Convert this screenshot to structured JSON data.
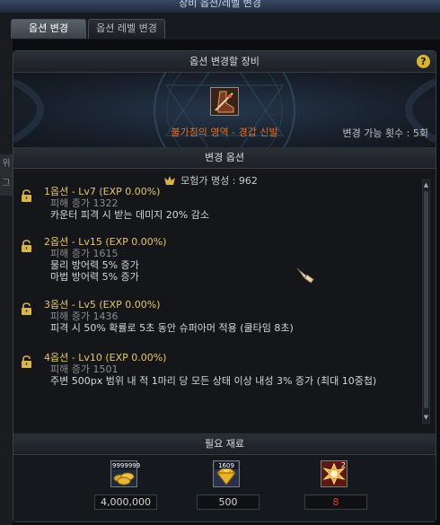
{
  "window": {
    "title": "장비 옵션/레벨 변경"
  },
  "tabs": [
    {
      "label": "옵션 변경",
      "active": true
    },
    {
      "label": "옵션 레벨 변경",
      "active": false
    }
  ],
  "side_strip": {
    "text": "위 그"
  },
  "equipment_section": {
    "title": "옵션 변경할 장비",
    "help_label": "?",
    "item_name": "불가침의 영역 - 경갑 신발",
    "change_count_label": "변경 가능 횟수 : 5회"
  },
  "options_section": {
    "title": "변경 옵션",
    "reputation": "모험가 명성 : 962",
    "options": [
      {
        "title": "1옵션 - Lv7 (EXP 0.00%)",
        "damage": "피해 증가 1322",
        "effects": [
          "카운터 피격 시 받는 데미지 20% 감소"
        ]
      },
      {
        "title": "2옵션 - Lv15 (EXP 0.00%)",
        "damage": "피해 증가 1615",
        "effects": [
          "물리 방어력 5% 증가",
          "마법 방어력 5% 증가"
        ]
      },
      {
        "title": "3옵션 - Lv5 (EXP 0.00%)",
        "damage": "피해 증가 1436",
        "effects": [
          "피격 시 50% 확률로 5초 동안 슈퍼아머 적용 (쿨타임 8초)"
        ]
      },
      {
        "title": "4옵션 - Lv10 (EXP 0.00%)",
        "damage": "피해 증가 1501",
        "effects": [
          "주변 500px 범위 내 적 1마리 당 모든 상태 이상 내성 3% 증가 (최대 10중첩)"
        ]
      }
    ]
  },
  "materials_section": {
    "title": "필요 재료",
    "items": [
      {
        "icon": "gold-coins-icon",
        "badge": "9999999",
        "amount": "4,000,000",
        "insufficient": false
      },
      {
        "icon": "gem-icon",
        "badge": "1609",
        "amount": "500",
        "insufficient": false
      },
      {
        "icon": "burst-icon",
        "badge": "2",
        "amount": "8",
        "insufficient": true
      }
    ]
  },
  "colors": {
    "item_name": "#e8701c",
    "option_title": "#e8c66a",
    "insufficient": "#e23b2a",
    "help_icon": "#d9b431"
  }
}
